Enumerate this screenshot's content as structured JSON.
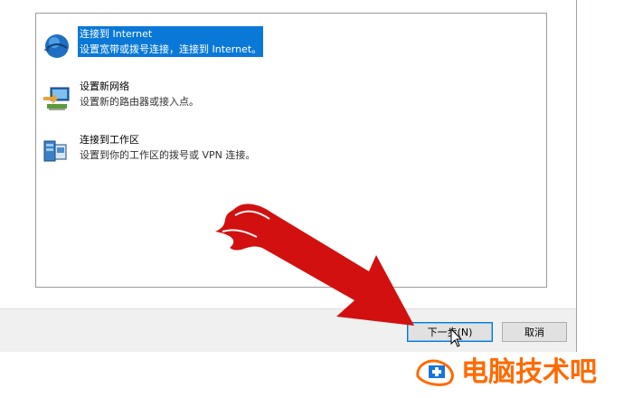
{
  "options": [
    {
      "title": "连接到 Internet",
      "desc": "设置宽带或拨号连接，连接到 Internet。",
      "selected": true,
      "icon": "globe-icon"
    },
    {
      "title": "设置新网络",
      "desc": "设置新的路由器或接入点。",
      "selected": false,
      "icon": "router-icon"
    },
    {
      "title": "连接到工作区",
      "desc": "设置到你的工作区的拨号或 VPN 连接。",
      "selected": false,
      "icon": "workplace-icon"
    }
  ],
  "footer": {
    "next_label": "下一步(N)",
    "cancel_label": "取消"
  },
  "watermark": {
    "text": "电脑技术吧"
  },
  "colors": {
    "selection": "#0a78d7",
    "arrow": "#d21010",
    "watermark": "#ff6a00"
  }
}
